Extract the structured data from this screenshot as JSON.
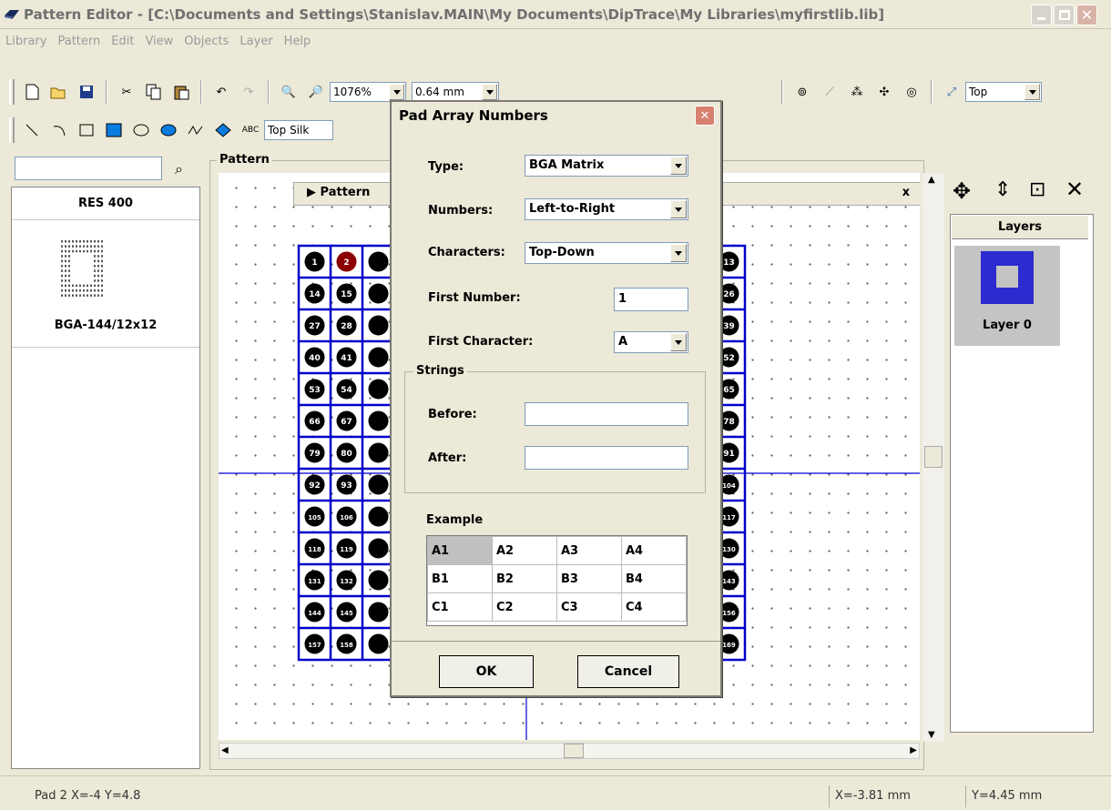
{
  "window": {
    "title": "Pattern Editor - [C:\\Documents and Settings\\Stanislav.MAIN\\My Documents\\DipTrace\\My Libraries\\myfirstlib.lib]"
  },
  "menu": [
    "Library",
    "Pattern",
    "Edit",
    "View",
    "Objects",
    "Layer",
    "Help"
  ],
  "toolbar1": {
    "zoom": "1076%",
    "grid": "0.64 mm",
    "side": "Top"
  },
  "toolbar2": {
    "layer": "Top Silk",
    "text_tool": "ABC"
  },
  "library": {
    "items": [
      {
        "name": "RES 400"
      },
      {
        "name": "BGA-144/12x12"
      }
    ]
  },
  "pattern_panel": {
    "group_label": "Pattern",
    "inner_tab": "Pattern",
    "close_glyph": "x"
  },
  "layers_panel": {
    "header": "Layers",
    "items": [
      {
        "name": "Layer 0"
      }
    ]
  },
  "pads": {
    "left_column_labels": [
      "1",
      "14",
      "27",
      "40",
      "53",
      "66",
      "79",
      "92",
      "105",
      "118",
      "131",
      "144",
      "157"
    ],
    "second_column_labels": [
      "2",
      "15",
      "28",
      "41",
      "54",
      "67",
      "80",
      "93",
      "106",
      "119",
      "132",
      "145",
      "158"
    ],
    "right_column_labels": [
      "13",
      "26",
      "39",
      "52",
      "65",
      "78",
      "91",
      "104",
      "117",
      "130",
      "143",
      "156",
      "169"
    ],
    "selected": "2"
  },
  "dialog": {
    "title": "Pad Array Numbers",
    "type_label": "Type:",
    "type_value": "BGA Matrix",
    "numbers_label": "Numbers:",
    "numbers_value": "Left-to-Right",
    "characters_label": "Characters:",
    "characters_value": "Top-Down",
    "first_number_label": "First Number:",
    "first_number_value": "1",
    "first_character_label": "First Character:",
    "first_character_value": "A",
    "strings_group": "Strings",
    "before_label": "Before:",
    "before_value": "",
    "after_label": "After:",
    "after_value": "",
    "example_label": "Example",
    "example_rows": [
      [
        "A1",
        "A2",
        "A3",
        "A4"
      ],
      [
        "B1",
        "B2",
        "B3",
        "B4"
      ],
      [
        "C1",
        "C2",
        "C3",
        "C4"
      ]
    ],
    "ok_label": "OK",
    "cancel_label": "Cancel"
  },
  "status": {
    "pad_info": "Pad 2  X=-4  Y=4.8",
    "x": "X=-3.81 mm",
    "y": "Y=4.45 mm"
  },
  "colors": {
    "pad_grid_blue": "#0000cc",
    "pad_selected": "#8b0000",
    "crosshair": "#0000cc"
  }
}
